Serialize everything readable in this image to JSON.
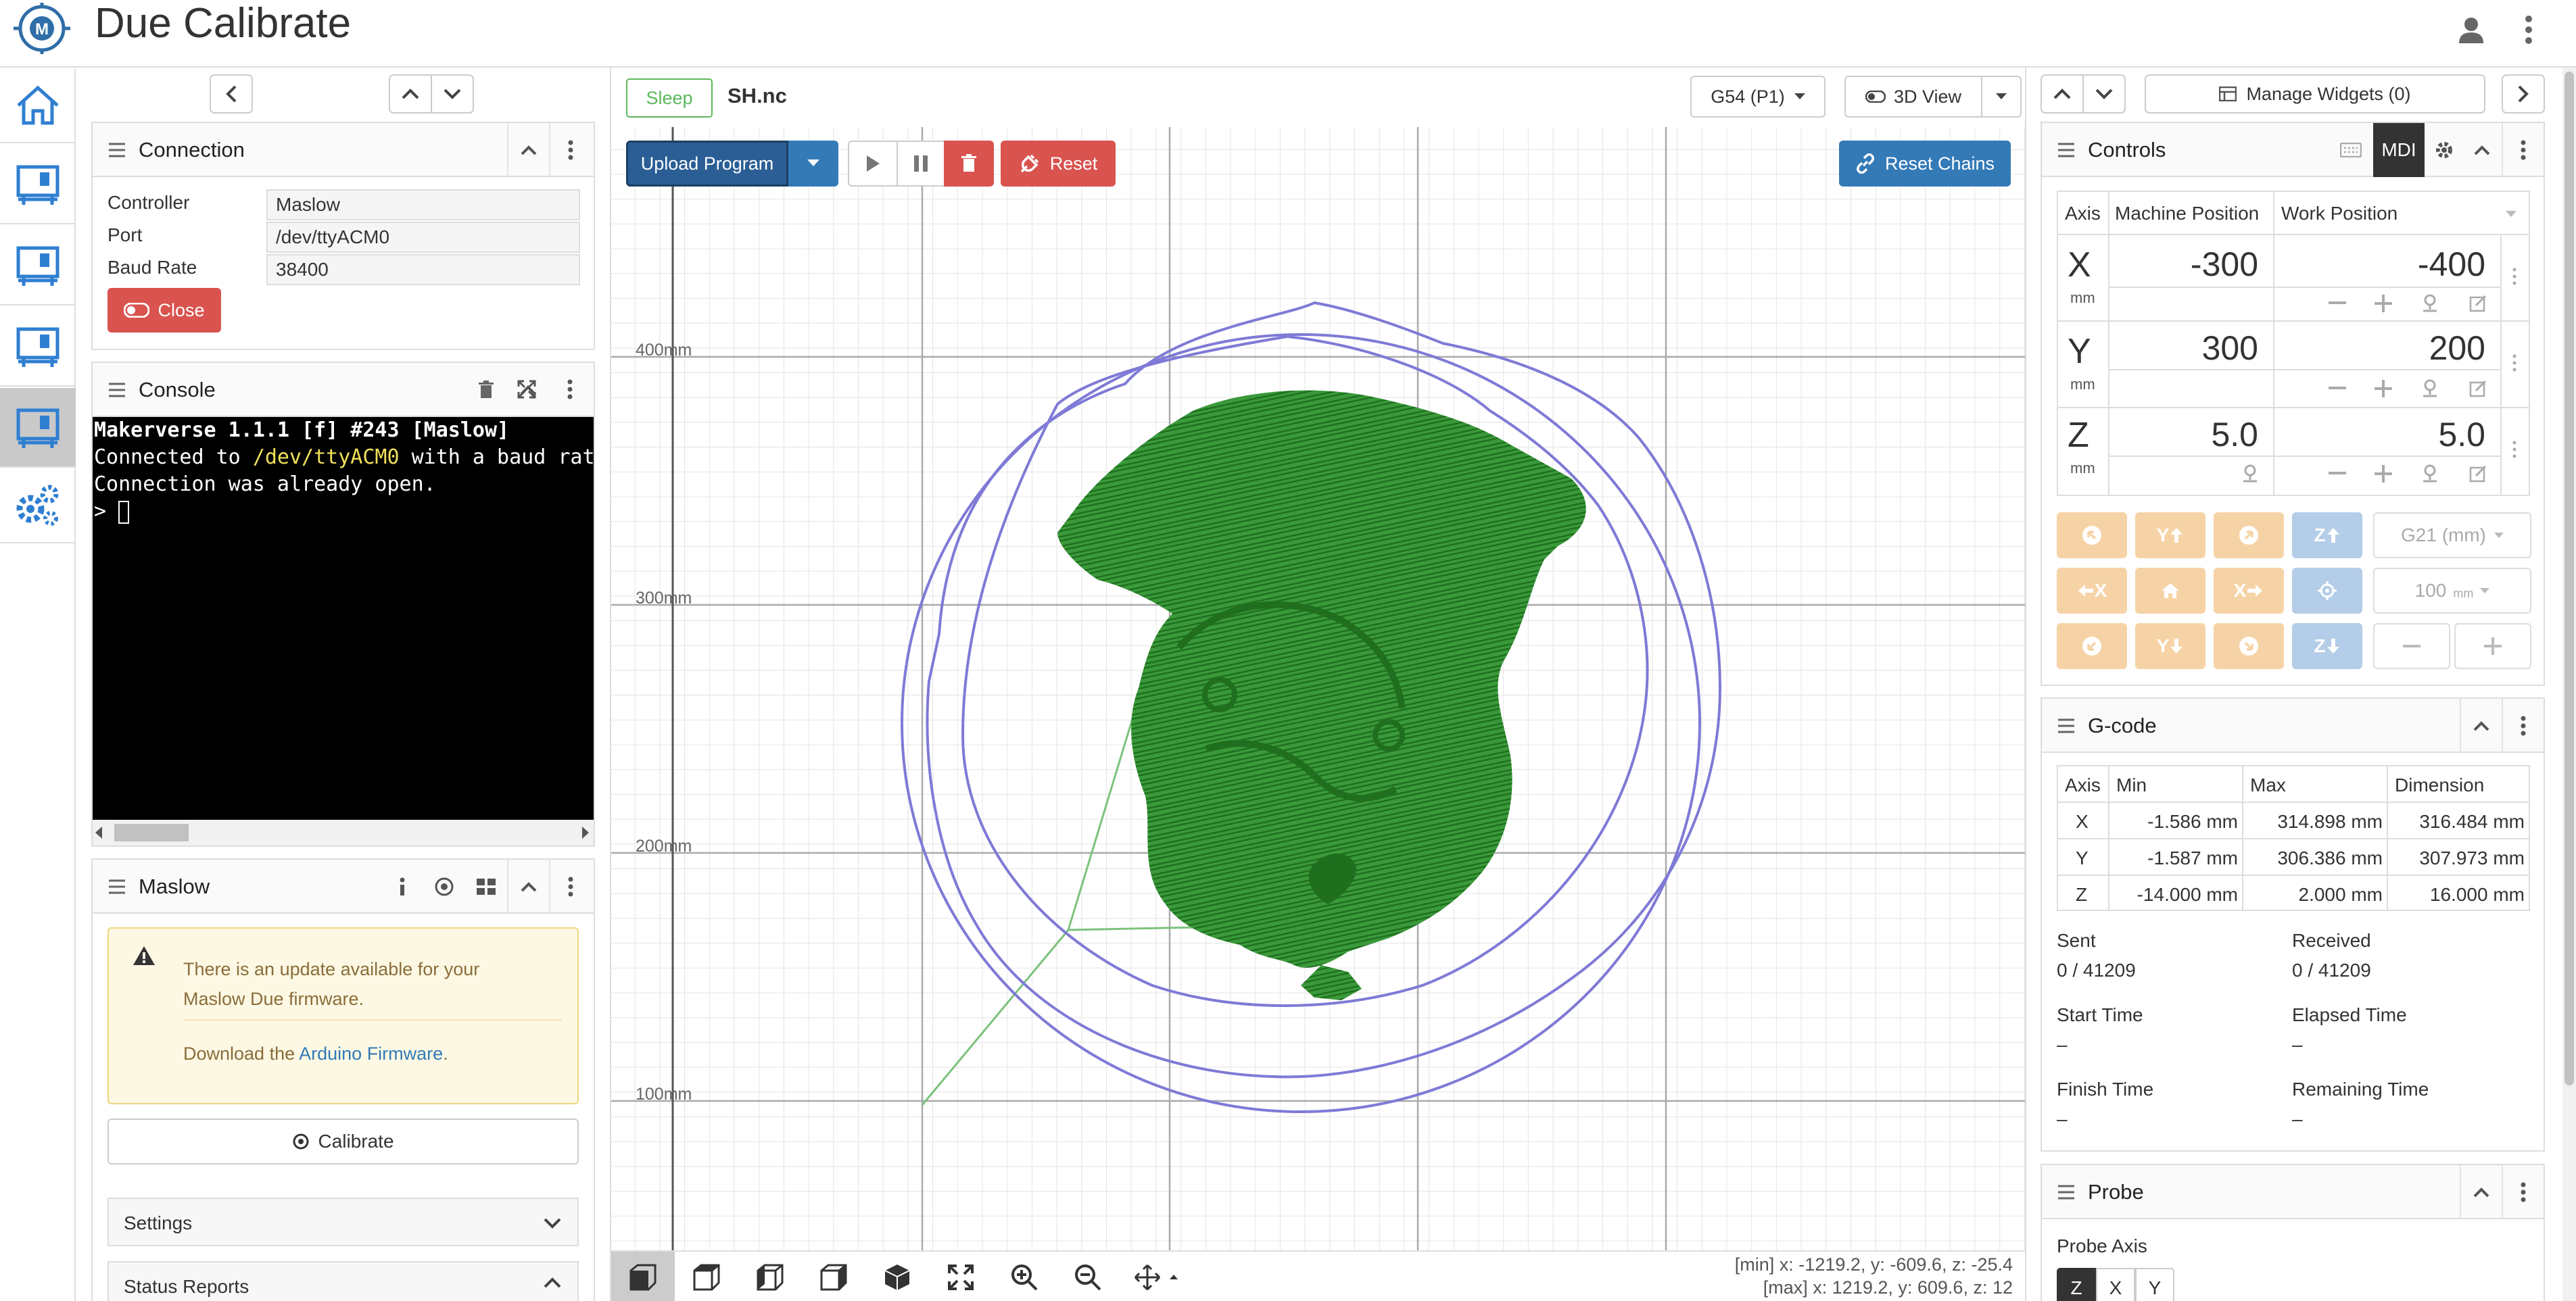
{
  "app": {
    "title": "Due Calibrate"
  },
  "connection": {
    "title": "Connection",
    "controller_label": "Controller",
    "controller_value": "Maslow",
    "port_label": "Port",
    "port_value": "/dev/ttyACM0",
    "baud_label": "Baud Rate",
    "baud_value": "38400",
    "close_label": "Close"
  },
  "console": {
    "title": "Console",
    "line1": "Makerverse 1.1.1 [f] #243 [Maslow]",
    "line2_pre": "Connected to ",
    "line2_port": "/dev/ttyACM0",
    "line2_post": " with a baud rate",
    "line3": "Connection was already open.",
    "prompt": ">"
  },
  "maslow": {
    "title": "Maslow",
    "alert_text": "There is an update available for your Maslow Due firmware.",
    "download_pre": "Download the ",
    "download_link": "Arduino Firmware",
    "download_post": ".",
    "calibrate_label": "Calibrate",
    "settings_label": "Settings",
    "status_reports_label": "Status Reports"
  },
  "visualizer": {
    "state_badge": "Sleep",
    "file_name": "SH.nc",
    "wcs_select": "G54 (P1)",
    "view_select": "3D View",
    "upload_label": "Upload Program",
    "reset_label": "Reset",
    "reset_chains_label": "Reset Chains",
    "grid_labels": [
      "400mm",
      "300mm",
      "200mm",
      "100mm"
    ],
    "min_readout": "[min] x: -1219.2, y: -609.6, z: -25.4",
    "max_readout": "[max] x: 1219.2, y: 609.6, z: 12"
  },
  "widgets": {
    "manage_label": "Manage Widgets (0)"
  },
  "controls": {
    "title": "Controls",
    "mdi_label": "MDI",
    "col_axis": "Axis",
    "col_machine": "Machine Position",
    "col_work": "Work Position",
    "unit": "mm",
    "axes": [
      {
        "name": "X",
        "machine": "-300",
        "work": "-400"
      },
      {
        "name": "Y",
        "machine": "300",
        "work": "200"
      },
      {
        "name": "Z",
        "machine": "5.0",
        "work": "5.0"
      }
    ],
    "units_select": "G21 (mm)",
    "step_select": "100",
    "step_unit": "mm",
    "jog_labels": {
      "y_plus": "Y",
      "z_plus": "Z",
      "x_minus": "X",
      "x_plus": "X",
      "y_minus": "Y",
      "z_minus": "Z"
    }
  },
  "gcode": {
    "title": "G-code",
    "headers": [
      "Axis",
      "Min",
      "Max",
      "Dimension"
    ],
    "rows": [
      [
        "X",
        "-1.586 mm",
        "314.898 mm",
        "316.484 mm"
      ],
      [
        "Y",
        "-1.587 mm",
        "306.386 mm",
        "307.973 mm"
      ],
      [
        "Z",
        "-14.000 mm",
        "2.000 mm",
        "16.000 mm"
      ]
    ],
    "sent_label": "Sent",
    "sent_value": "0 / 41209",
    "received_label": "Received",
    "received_value": "0 / 41209",
    "start_label": "Start Time",
    "start_value": "–",
    "elapsed_label": "Elapsed Time",
    "elapsed_value": "–",
    "finish_label": "Finish Time",
    "finish_value": "–",
    "remaining_label": "Remaining Time",
    "remaining_value": "–"
  },
  "probe": {
    "title": "Probe",
    "axis_label": "Probe Axis",
    "axes": [
      "Z",
      "X",
      "Y"
    ]
  },
  "colors": {
    "primary": "#337ab7",
    "danger": "#d9534f",
    "success_green": "#5cb85c",
    "toolpath_green": "#2e8b2e",
    "outline_purple": "#8884d8",
    "jog_orange": "#f6d3a6",
    "jog_blue": "#b4cde8"
  }
}
